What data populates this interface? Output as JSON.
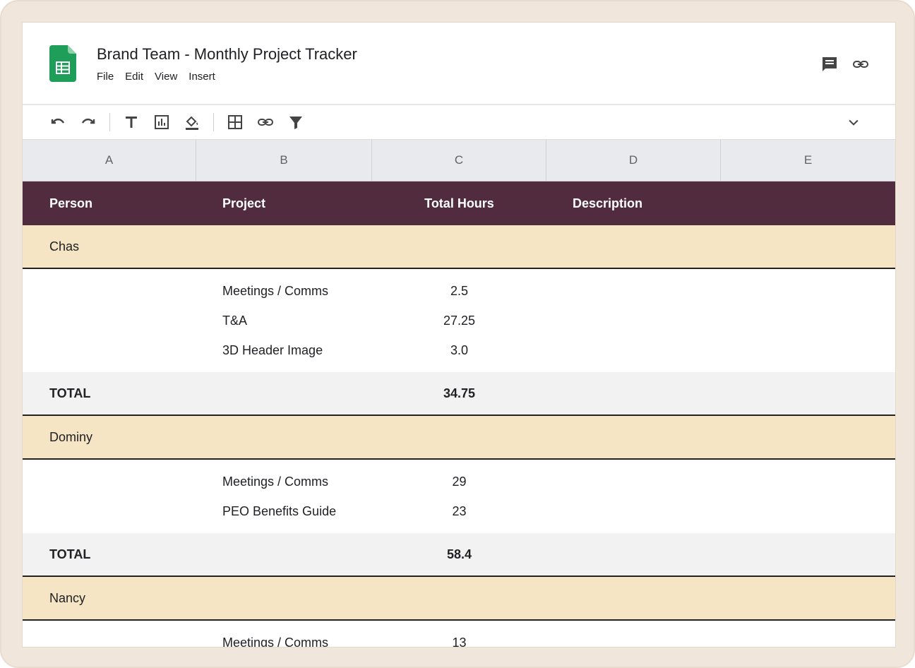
{
  "app": {
    "title": "Brand Team - Monthly Project Tracker",
    "menu": [
      "File",
      "Edit",
      "View",
      "Insert"
    ],
    "brand_color": "#1e9e59"
  },
  "title_actions": {
    "comment_icon": "comment-icon",
    "link_icon": "link-icon"
  },
  "toolbar": {
    "icons": [
      "undo-icon",
      "redo-icon",
      "text-format-icon",
      "chart-icon",
      "fill-color-icon",
      "borders-icon",
      "link-icon",
      "filter-icon",
      "chevron-down-icon"
    ]
  },
  "columns": [
    "A",
    "B",
    "C",
    "D",
    "E"
  ],
  "header": {
    "person": "Person",
    "project": "Project",
    "hours": "Total Hours",
    "description": "Description"
  },
  "groups": [
    {
      "person": "Chas",
      "entries": [
        {
          "project": "Meetings / Comms",
          "hours": "2.5"
        },
        {
          "project": "T&A",
          "hours": "27.25"
        },
        {
          "project": "3D Header Image",
          "hours": "3.0"
        }
      ],
      "total_label": "TOTAL",
      "total": "34.75"
    },
    {
      "person": "Dominy",
      "entries": [
        {
          "project": "Meetings / Comms",
          "hours": "29"
        },
        {
          "project": "PEO Benefits Guide",
          "hours": "23"
        }
      ],
      "total_label": "TOTAL",
      "total": "58.4"
    },
    {
      "person": "Nancy",
      "entries": [
        {
          "project": "Meetings / Comms",
          "hours": "13"
        }
      ]
    }
  ],
  "colors": {
    "header_bg": "#502c3e",
    "person_bg": "#f5e5c5",
    "total_bg": "#f2f2f2",
    "frame_bg": "#f0e6dc"
  }
}
